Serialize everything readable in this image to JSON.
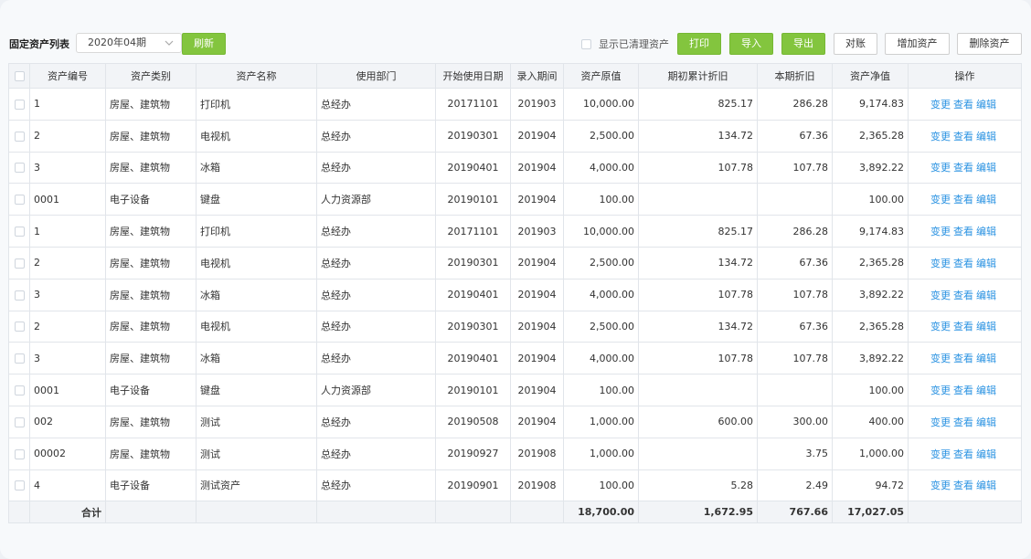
{
  "toolbar": {
    "title": "固定资产列表",
    "period": "2020年04期",
    "refresh": "刷新",
    "show_cleared": "显示已清理资产",
    "print": "打印",
    "import": "导入",
    "export": "导出",
    "reconcile": "对账",
    "add_asset": "增加资产",
    "delete_asset": "删除资产"
  },
  "columns": [
    "资产编号",
    "资产类别",
    "资产名称",
    "使用部门",
    "开始使用日期",
    "录入期间",
    "资产原值",
    "期初累计折旧",
    "本期折旧",
    "资产净值",
    "操作"
  ],
  "actions": {
    "change": "变更",
    "view": "查看",
    "edit": "编辑"
  },
  "rows": [
    {
      "code": "1",
      "category": "房屋、建筑物",
      "name": "打印机",
      "dept": "总经办",
      "start": "20171101",
      "period": "201903",
      "original": "10,000.00",
      "accum": "825.17",
      "current": "286.28",
      "net": "9,174.83"
    },
    {
      "code": "2",
      "category": "房屋、建筑物",
      "name": "电视机",
      "dept": "总经办",
      "start": "20190301",
      "period": "201904",
      "original": "2,500.00",
      "accum": "134.72",
      "current": "67.36",
      "net": "2,365.28"
    },
    {
      "code": "3",
      "category": "房屋、建筑物",
      "name": "冰箱",
      "dept": "总经办",
      "start": "20190401",
      "period": "201904",
      "original": "4,000.00",
      "accum": "107.78",
      "current": "107.78",
      "net": "3,892.22"
    },
    {
      "code": "0001",
      "category": "电子设备",
      "name": "键盘",
      "dept": "人力资源部",
      "start": "20190101",
      "period": "201904",
      "original": "100.00",
      "accum": "",
      "current": "",
      "net": "100.00"
    },
    {
      "code": "1",
      "category": "房屋、建筑物",
      "name": "打印机",
      "dept": "总经办",
      "start": "20171101",
      "period": "201903",
      "original": "10,000.00",
      "accum": "825.17",
      "current": "286.28",
      "net": "9,174.83"
    },
    {
      "code": "2",
      "category": "房屋、建筑物",
      "name": "电视机",
      "dept": "总经办",
      "start": "20190301",
      "period": "201904",
      "original": "2,500.00",
      "accum": "134.72",
      "current": "67.36",
      "net": "2,365.28"
    },
    {
      "code": "3",
      "category": "房屋、建筑物",
      "name": "冰箱",
      "dept": "总经办",
      "start": "20190401",
      "period": "201904",
      "original": "4,000.00",
      "accum": "107.78",
      "current": "107.78",
      "net": "3,892.22"
    },
    {
      "code": "2",
      "category": "房屋、建筑物",
      "name": "电视机",
      "dept": "总经办",
      "start": "20190301",
      "period": "201904",
      "original": "2,500.00",
      "accum": "134.72",
      "current": "67.36",
      "net": "2,365.28"
    },
    {
      "code": "3",
      "category": "房屋、建筑物",
      "name": "冰箱",
      "dept": "总经办",
      "start": "20190401",
      "period": "201904",
      "original": "4,000.00",
      "accum": "107.78",
      "current": "107.78",
      "net": "3,892.22"
    },
    {
      "code": "0001",
      "category": "电子设备",
      "name": "键盘",
      "dept": "人力资源部",
      "start": "20190101",
      "period": "201904",
      "original": "100.00",
      "accum": "",
      "current": "",
      "net": "100.00"
    },
    {
      "code": "002",
      "category": "房屋、建筑物",
      "name": "测试",
      "dept": "总经办",
      "start": "20190508",
      "period": "201904",
      "original": "1,000.00",
      "accum": "600.00",
      "current": "300.00",
      "net": "400.00"
    },
    {
      "code": "00002",
      "category": "房屋、建筑物",
      "name": "测试",
      "dept": "总经办",
      "start": "20190927",
      "period": "201908",
      "original": "1,000.00",
      "accum": "",
      "current": "3.75",
      "net": "1,000.00"
    },
    {
      "code": "4",
      "category": "电子设备",
      "name": "测试资产",
      "dept": "总经办",
      "start": "20190901",
      "period": "201908",
      "original": "100.00",
      "accum": "5.28",
      "current": "2.49",
      "net": "94.72"
    }
  ],
  "totals": {
    "label": "合计",
    "original": "18,700.00",
    "accum": "1,672.95",
    "current": "767.66",
    "net": "17,027.05"
  }
}
